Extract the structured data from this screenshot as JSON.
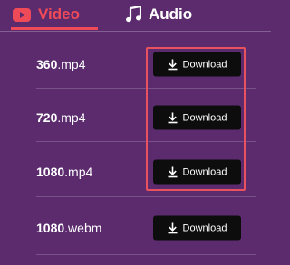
{
  "tabs": {
    "video_label": "Video",
    "audio_label": "Audio",
    "video_icon": "youtube-play-icon",
    "audio_icon": "music-note-icon",
    "active": "video"
  },
  "rows": [
    {
      "name": "360",
      "ext": ".mp4",
      "button_label": "Download"
    },
    {
      "name": "720",
      "ext": ".mp4",
      "button_label": "Download"
    },
    {
      "name": "1080",
      "ext": ".mp4",
      "button_label": "Download"
    },
    {
      "name": "1080",
      "ext": ".webm",
      "button_label": "Download"
    }
  ],
  "colors": {
    "background": "#5b2b6e",
    "accent": "#ef4a57",
    "button": "#0d0d0d",
    "highlight": "#e8525e"
  }
}
